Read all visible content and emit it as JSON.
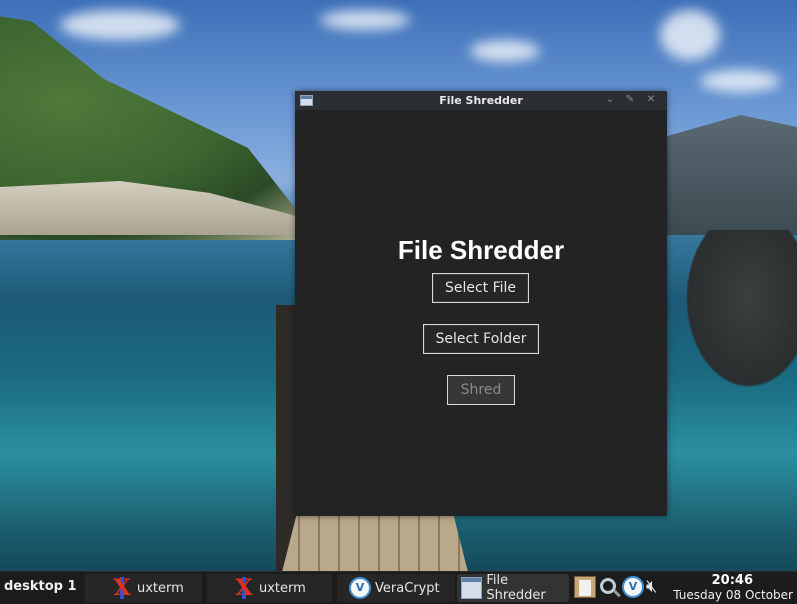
{
  "window": {
    "title": "File Shredder",
    "heading": "File Shredder",
    "buttons": {
      "select_file": "Select File",
      "select_folder": "Select Folder",
      "shred": "Shred"
    },
    "titlebar_icons": [
      "minimize-icon",
      "maximize-icon",
      "close-icon"
    ]
  },
  "taskbar": {
    "desktop_label": "desktop 1",
    "tasks": [
      {
        "label": "uxterm",
        "icon": "x-icon"
      },
      {
        "label": "uxterm",
        "icon": "x-icon"
      },
      {
        "label": "VeraCrypt",
        "icon": "veracrypt-icon"
      },
      {
        "label": "File Shredder",
        "icon": "window-icon"
      }
    ],
    "tray_icons": [
      "clipboard-icon",
      "magnifier-icon",
      "veracrypt-icon",
      "speaker-muted-icon"
    ],
    "clock": {
      "time": "20:46",
      "date": "Tuesday 08 October"
    }
  },
  "colors": {
    "window_bg": "#232323",
    "titlebar_bg": "#2b2e33",
    "taskbar_bg": "#1c1c1c"
  }
}
